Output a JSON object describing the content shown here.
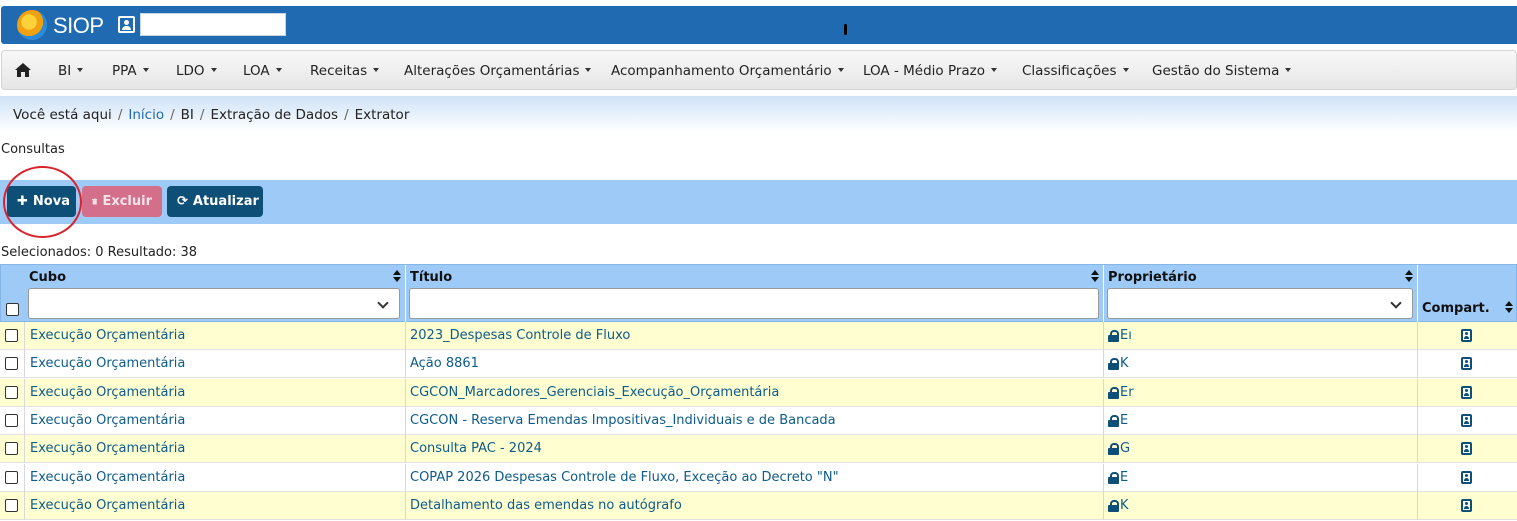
{
  "app": {
    "logo_text": "SIOP",
    "user_value": ""
  },
  "menu": {
    "items": [
      {
        "label": "BI"
      },
      {
        "label": "PPA"
      },
      {
        "label": "LDO"
      },
      {
        "label": "LOA"
      },
      {
        "label": "Receitas"
      },
      {
        "label": "Alterações Orçamentárias"
      },
      {
        "label": "Acompanhamento Orçamentário"
      },
      {
        "label": "LOA - Médio Prazo"
      },
      {
        "label": "Classificações"
      },
      {
        "label": "Gestão do Sistema"
      }
    ]
  },
  "breadcrumb": {
    "prefix": "Você está aqui",
    "items": [
      "Início",
      "BI",
      "Extração de Dados",
      "Extrator"
    ],
    "separator": "/"
  },
  "section_title": "Consultas",
  "toolbar": {
    "nova_label": "Nova",
    "excluir_label": "Excluir",
    "atualizar_label": "Atualizar"
  },
  "status": "Selecionados: 0 Resultado: 38",
  "table": {
    "headers": {
      "cubo": "Cubo",
      "titulo": "Título",
      "proprietario": "Proprietário",
      "compart": "Compart."
    },
    "rows": [
      {
        "cubo": "Execução Orçamentária",
        "titulo": "2023_Despesas Controle de Fluxo",
        "proprietario": "Eı"
      },
      {
        "cubo": "Execução Orçamentária",
        "titulo": "Ação 8861",
        "proprietario": "K"
      },
      {
        "cubo": "Execução Orçamentária",
        "titulo": "CGCON_Marcadores_Gerenciais_Execução_Orçamentária",
        "proprietario": "Er"
      },
      {
        "cubo": "Execução Orçamentária",
        "titulo": "CGCON - Reserva Emendas Impositivas_Individuais e de Bancada",
        "proprietario": "E"
      },
      {
        "cubo": "Execução Orçamentária",
        "titulo": "Consulta PAC - 2024",
        "proprietario": "G"
      },
      {
        "cubo": "Execução Orçamentária",
        "titulo": "COPAP 2026 Despesas Controle de Fluxo, Exceção ao Decreto \"N\"",
        "proprietario": "E"
      },
      {
        "cubo": "Execução Orçamentária",
        "titulo": "Detalhamento das emendas no autógrafo",
        "proprietario": "K"
      }
    ]
  },
  "colors": {
    "header_blue": "#1f6ab1",
    "toolbar_blue": "#9ecaf8",
    "button_dark": "#0d4f77",
    "button_danger_disabled": "#d36f8b",
    "row_highlight": "#fefed0",
    "annotation_red": "#d9232d"
  }
}
